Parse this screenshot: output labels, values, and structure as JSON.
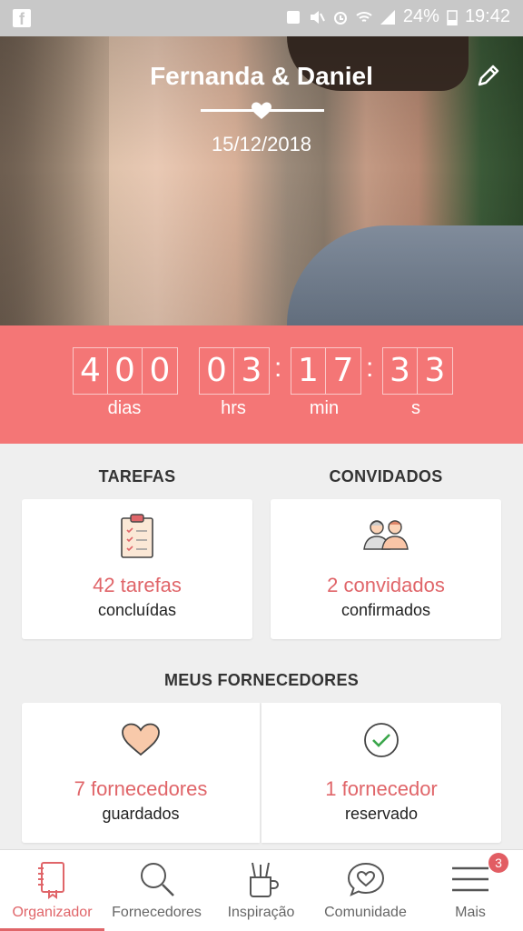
{
  "status_bar": {
    "battery": "24%",
    "time": "19:42"
  },
  "header": {
    "couple_name": "Fernanda & Daniel",
    "wedding_date": "15/12/2018"
  },
  "countdown": {
    "days": [
      "4",
      "0",
      "0"
    ],
    "hours": [
      "0",
      "3"
    ],
    "minutes": [
      "1",
      "7"
    ],
    "seconds": [
      "3",
      "3"
    ],
    "labels": {
      "days": "dias",
      "hours": "hrs",
      "minutes": "min",
      "seconds": "s"
    }
  },
  "tasks": {
    "title": "TAREFAS",
    "count": "42 tarefas",
    "status": "concluídas"
  },
  "guests": {
    "title": "CONVIDADOS",
    "count": "2 convidados",
    "status": "confirmados"
  },
  "vendors": {
    "title": "MEUS FORNECEDORES",
    "saved": {
      "count": "7 fornecedores",
      "status": "guardados"
    },
    "booked": {
      "count": "1 fornecedor",
      "status": "reservado"
    }
  },
  "nav": {
    "items": [
      {
        "label": "Organizador",
        "icon": "notebook-icon",
        "active": true
      },
      {
        "label": "Fornecedores",
        "icon": "search-icon"
      },
      {
        "label": "Inspiração",
        "icon": "tools-cup-icon"
      },
      {
        "label": "Comunidade",
        "icon": "chat-heart-icon"
      },
      {
        "label": "Mais",
        "icon": "menu-icon"
      }
    ],
    "badge": "3"
  },
  "colors": {
    "accent": "#f47676",
    "accent_text": "#e06569",
    "background": "#efefef"
  }
}
